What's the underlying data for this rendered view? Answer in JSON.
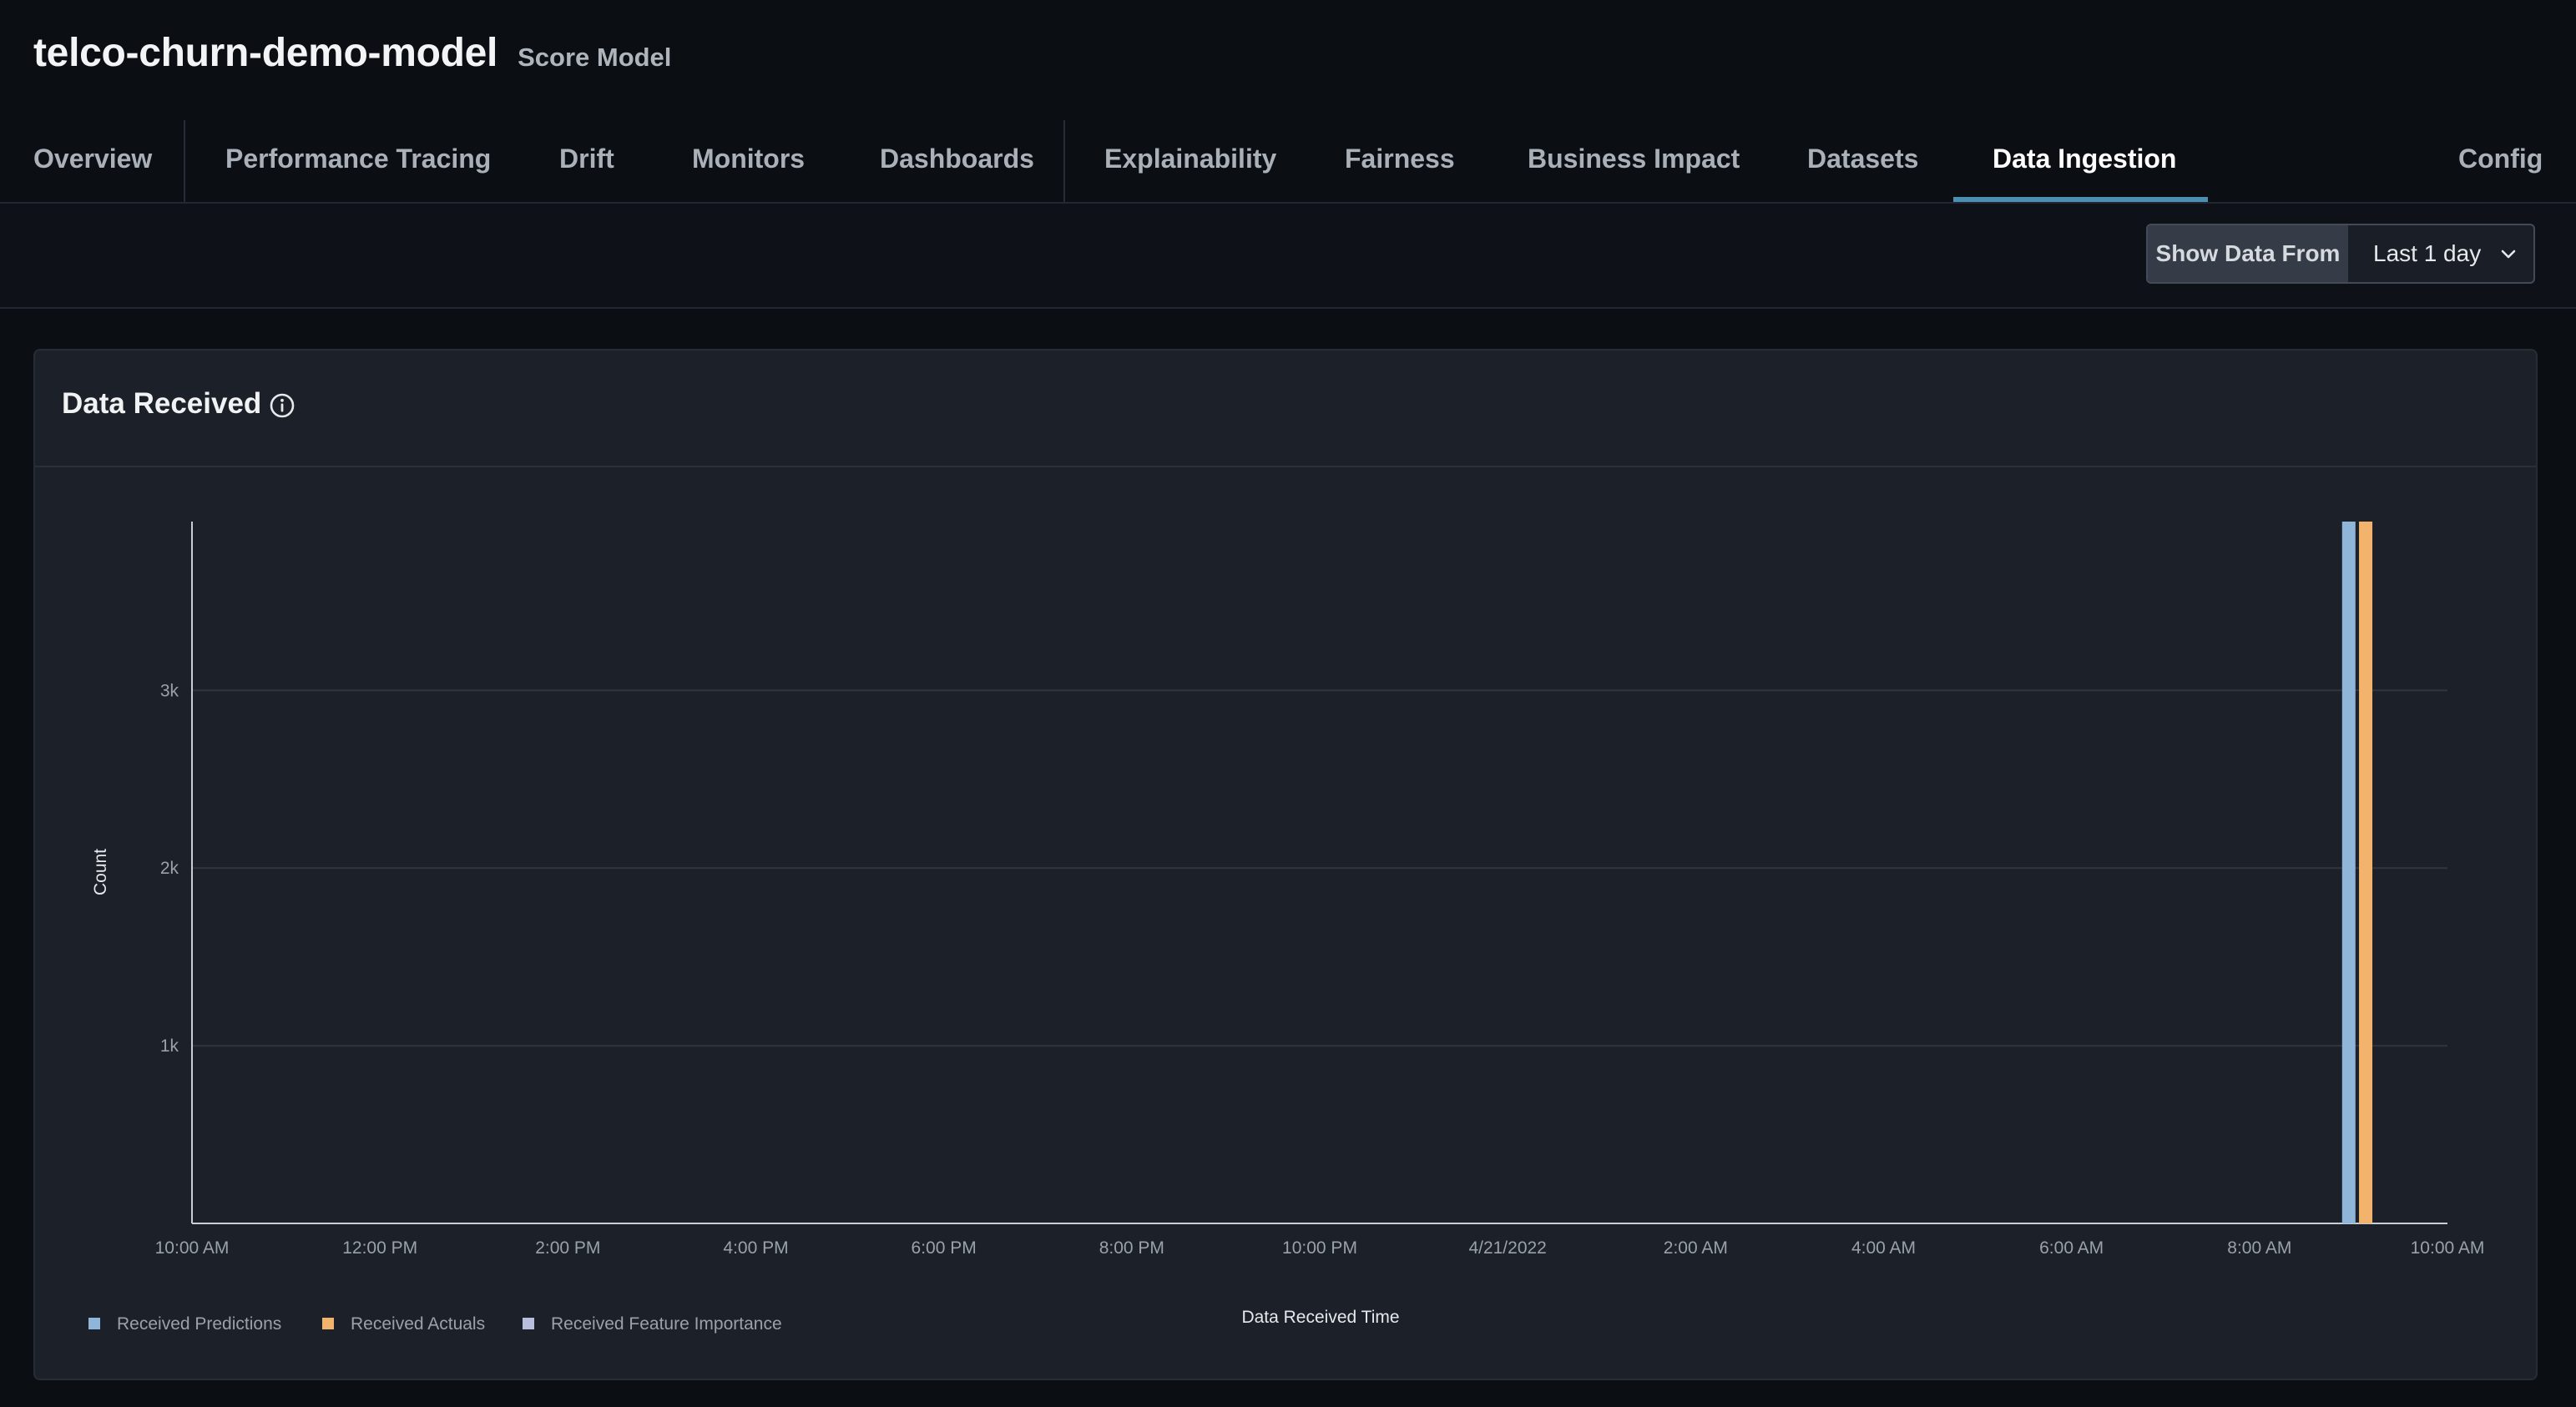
{
  "header": {
    "model_name": "telco-churn-demo-model",
    "model_type": "Score Model"
  },
  "tabs": [
    {
      "label": "Overview"
    },
    {
      "label": "Performance Tracing"
    },
    {
      "label": "Drift"
    },
    {
      "label": "Monitors"
    },
    {
      "label": "Dashboards"
    },
    {
      "label": "Explainability"
    },
    {
      "label": "Fairness"
    },
    {
      "label": "Business Impact"
    },
    {
      "label": "Datasets"
    },
    {
      "label": "Data Ingestion",
      "active": true
    },
    {
      "label": "Config"
    }
  ],
  "toolbar": {
    "range_label": "Show Data From",
    "range_value": "Last 1 day"
  },
  "card": {
    "title": "Data Received"
  },
  "icons": {
    "info": "info-icon",
    "dropdown": "chevron-down-icon"
  },
  "colors": {
    "accent": "#4d8eb3",
    "predictions": "#8fb6d9",
    "actuals": "#f2b46c",
    "feature_importance": "#b7bfdc"
  },
  "chart_data": {
    "type": "bar",
    "xlabel": "Data Received Time",
    "ylabel": "Count",
    "x_ticks": [
      "10:00 AM",
      "12:00 PM",
      "2:00 PM",
      "4:00 PM",
      "6:00 PM",
      "8:00 PM",
      "10:00 PM",
      "4/21/2022",
      "2:00 AM",
      "4:00 AM",
      "6:00 AM",
      "8:00 AM",
      "10:00 AM"
    ],
    "x_range_hours": [
      0,
      24
    ],
    "y_ticks": [
      1000,
      2000,
      3000
    ],
    "y_tick_labels": [
      "1k",
      "2k",
      "3k"
    ],
    "ylim": [
      0,
      3950
    ],
    "grid": true,
    "legend_position": "bottom-left",
    "series": [
      {
        "name": "Received Predictions",
        "color": "#8fb6d9",
        "points": [
          {
            "hour": 22.95,
            "value": 3950
          }
        ]
      },
      {
        "name": "Received Actuals",
        "color": "#f2b46c",
        "points": [
          {
            "hour": 23.13,
            "value": 3950
          }
        ]
      },
      {
        "name": "Received Feature Importance",
        "color": "#b7bfdc",
        "points": []
      }
    ]
  }
}
